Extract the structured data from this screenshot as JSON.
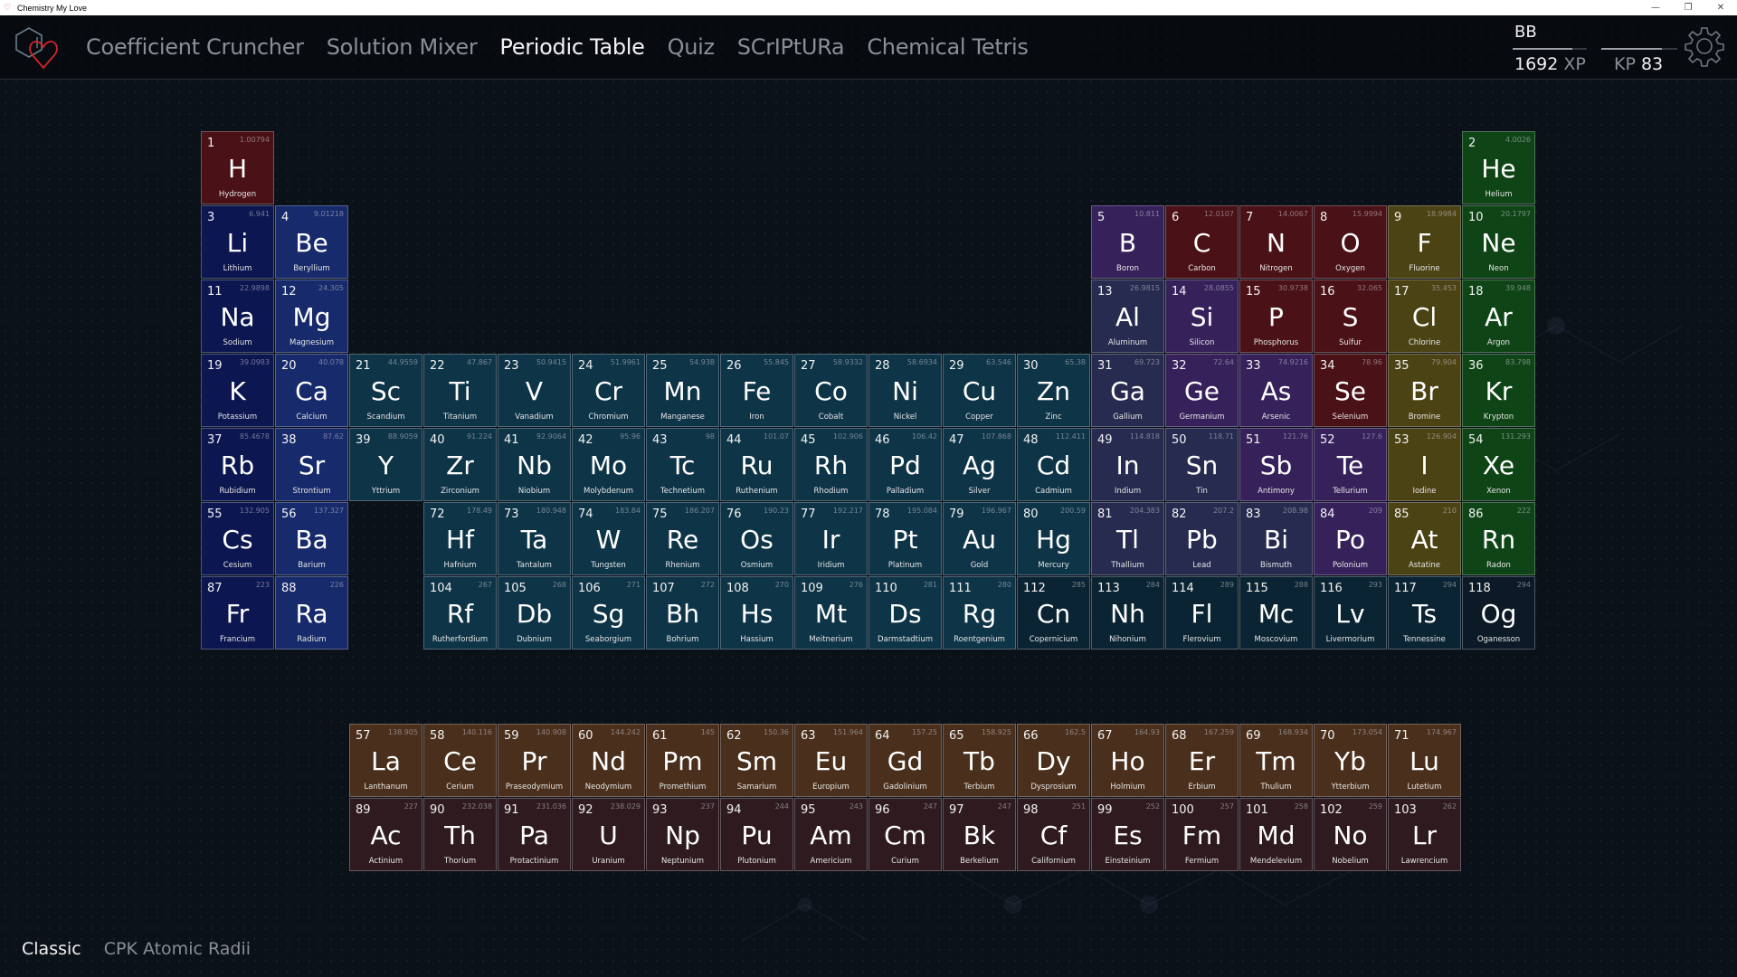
{
  "window": {
    "title": "Chemistry My Love",
    "controls": [
      "minimize",
      "restore",
      "close"
    ]
  },
  "nav": {
    "items": [
      {
        "label": "Coefficient Cruncher",
        "active": false
      },
      {
        "label": "Solution Mixer",
        "active": false
      },
      {
        "label": "Periodic Table",
        "active": true
      },
      {
        "label": "Quiz",
        "active": false
      },
      {
        "label": "SCrIPtURa",
        "active": false
      },
      {
        "label": "Chemical Tetris",
        "active": false
      }
    ]
  },
  "user": {
    "name": "BB",
    "xp_value": "1692",
    "xp_unit": "XP",
    "kp_unit": "KP",
    "kp_value": "83",
    "xp_progress": 0.8,
    "kp_progress": 0.8
  },
  "colors": {
    "nonmetal": "#4a1116",
    "alkali": "#0c1650",
    "alkaline": "#172a6b",
    "transition": "#0e3447",
    "post_transition": "#272b4f",
    "metalloid": "#36215b",
    "halogen": "#4c4314",
    "noble": "#0f4516",
    "lanthanide": "#4a2f1c",
    "actinide": "#2f1b1f",
    "unknown": "#0b2433",
    "unknown_dark": "#0b1a26"
  },
  "elements": [
    {
      "n": "1",
      "m": "1.00794",
      "s": "H",
      "name": "Hydrogen",
      "row": 1,
      "col": 1,
      "cat": "nonmetal"
    },
    {
      "n": "2",
      "m": "4.0026",
      "s": "He",
      "name": "Helium",
      "row": 1,
      "col": 18,
      "cat": "noble"
    },
    {
      "n": "3",
      "m": "6.941",
      "s": "Li",
      "name": "Lithium",
      "row": 2,
      "col": 1,
      "cat": "alkali"
    },
    {
      "n": "4",
      "m": "9.01218",
      "s": "Be",
      "name": "Beryllium",
      "row": 2,
      "col": 2,
      "cat": "alkaline"
    },
    {
      "n": "5",
      "m": "10.811",
      "s": "B",
      "name": "Boron",
      "row": 2,
      "col": 13,
      "cat": "metalloid"
    },
    {
      "n": "6",
      "m": "12.0107",
      "s": "C",
      "name": "Carbon",
      "row": 2,
      "col": 14,
      "cat": "nonmetal"
    },
    {
      "n": "7",
      "m": "14.0067",
      "s": "N",
      "name": "Nitrogen",
      "row": 2,
      "col": 15,
      "cat": "nonmetal"
    },
    {
      "n": "8",
      "m": "15.9994",
      "s": "O",
      "name": "Oxygen",
      "row": 2,
      "col": 16,
      "cat": "nonmetal"
    },
    {
      "n": "9",
      "m": "18.9984",
      "s": "F",
      "name": "Fluorine",
      "row": 2,
      "col": 17,
      "cat": "halogen"
    },
    {
      "n": "10",
      "m": "20.1797",
      "s": "Ne",
      "name": "Neon",
      "row": 2,
      "col": 18,
      "cat": "noble"
    },
    {
      "n": "11",
      "m": "22.9898",
      "s": "Na",
      "name": "Sodium",
      "row": 3,
      "col": 1,
      "cat": "alkali"
    },
    {
      "n": "12",
      "m": "24.305",
      "s": "Mg",
      "name": "Magnesium",
      "row": 3,
      "col": 2,
      "cat": "alkaline"
    },
    {
      "n": "13",
      "m": "26.9815",
      "s": "Al",
      "name": "Aluminum",
      "row": 3,
      "col": 13,
      "cat": "post_transition"
    },
    {
      "n": "14",
      "m": "28.0855",
      "s": "Si",
      "name": "Silicon",
      "row": 3,
      "col": 14,
      "cat": "metalloid"
    },
    {
      "n": "15",
      "m": "30.9738",
      "s": "P",
      "name": "Phosphorus",
      "row": 3,
      "col": 15,
      "cat": "nonmetal"
    },
    {
      "n": "16",
      "m": "32.065",
      "s": "S",
      "name": "Sulfur",
      "row": 3,
      "col": 16,
      "cat": "nonmetal"
    },
    {
      "n": "17",
      "m": "35.453",
      "s": "Cl",
      "name": "Chlorine",
      "row": 3,
      "col": 17,
      "cat": "halogen"
    },
    {
      "n": "18",
      "m": "39.948",
      "s": "Ar",
      "name": "Argon",
      "row": 3,
      "col": 18,
      "cat": "noble"
    },
    {
      "n": "19",
      "m": "39.0983",
      "s": "K",
      "name": "Potassium",
      "row": 4,
      "col": 1,
      "cat": "alkali"
    },
    {
      "n": "20",
      "m": "40.078",
      "s": "Ca",
      "name": "Calcium",
      "row": 4,
      "col": 2,
      "cat": "alkaline"
    },
    {
      "n": "21",
      "m": "44.9559",
      "s": "Sc",
      "name": "Scandium",
      "row": 4,
      "col": 3,
      "cat": "transition"
    },
    {
      "n": "22",
      "m": "47.867",
      "s": "Ti",
      "name": "Titanium",
      "row": 4,
      "col": 4,
      "cat": "transition"
    },
    {
      "n": "23",
      "m": "50.9415",
      "s": "V",
      "name": "Vanadium",
      "row": 4,
      "col": 5,
      "cat": "transition"
    },
    {
      "n": "24",
      "m": "51.9961",
      "s": "Cr",
      "name": "Chromium",
      "row": 4,
      "col": 6,
      "cat": "transition"
    },
    {
      "n": "25",
      "m": "54.938",
      "s": "Mn",
      "name": "Manganese",
      "row": 4,
      "col": 7,
      "cat": "transition"
    },
    {
      "n": "26",
      "m": "55.845",
      "s": "Fe",
      "name": "Iron",
      "row": 4,
      "col": 8,
      "cat": "transition"
    },
    {
      "n": "27",
      "m": "58.9332",
      "s": "Co",
      "name": "Cobalt",
      "row": 4,
      "col": 9,
      "cat": "transition"
    },
    {
      "n": "28",
      "m": "58.6934",
      "s": "Ni",
      "name": "Nickel",
      "row": 4,
      "col": 10,
      "cat": "transition"
    },
    {
      "n": "29",
      "m": "63.546",
      "s": "Cu",
      "name": "Copper",
      "row": 4,
      "col": 11,
      "cat": "transition"
    },
    {
      "n": "30",
      "m": "65.38",
      "s": "Zn",
      "name": "Zinc",
      "row": 4,
      "col": 12,
      "cat": "transition"
    },
    {
      "n": "31",
      "m": "69.723",
      "s": "Ga",
      "name": "Gallium",
      "row": 4,
      "col": 13,
      "cat": "post_transition"
    },
    {
      "n": "32",
      "m": "72.64",
      "s": "Ge",
      "name": "Germanium",
      "row": 4,
      "col": 14,
      "cat": "metalloid"
    },
    {
      "n": "33",
      "m": "74.9216",
      "s": "As",
      "name": "Arsenic",
      "row": 4,
      "col": 15,
      "cat": "metalloid"
    },
    {
      "n": "34",
      "m": "78.96",
      "s": "Se",
      "name": "Selenium",
      "row": 4,
      "col": 16,
      "cat": "nonmetal"
    },
    {
      "n": "35",
      "m": "79.904",
      "s": "Br",
      "name": "Bromine",
      "row": 4,
      "col": 17,
      "cat": "halogen"
    },
    {
      "n": "36",
      "m": "83.798",
      "s": "Kr",
      "name": "Krypton",
      "row": 4,
      "col": 18,
      "cat": "noble"
    },
    {
      "n": "37",
      "m": "85.4678",
      "s": "Rb",
      "name": "Rubidium",
      "row": 5,
      "col": 1,
      "cat": "alkali"
    },
    {
      "n": "38",
      "m": "87.62",
      "s": "Sr",
      "name": "Strontium",
      "row": 5,
      "col": 2,
      "cat": "alkaline"
    },
    {
      "n": "39",
      "m": "88.9059",
      "s": "Y",
      "name": "Yttrium",
      "row": 5,
      "col": 3,
      "cat": "transition"
    },
    {
      "n": "40",
      "m": "91.224",
      "s": "Zr",
      "name": "Zirconium",
      "row": 5,
      "col": 4,
      "cat": "transition"
    },
    {
      "n": "41",
      "m": "92.9064",
      "s": "Nb",
      "name": "Niobium",
      "row": 5,
      "col": 5,
      "cat": "transition"
    },
    {
      "n": "42",
      "m": "95.96",
      "s": "Mo",
      "name": "Molybdenum",
      "row": 5,
      "col": 6,
      "cat": "transition"
    },
    {
      "n": "43",
      "m": "98",
      "s": "Tc",
      "name": "Technetium",
      "row": 5,
      "col": 7,
      "cat": "transition"
    },
    {
      "n": "44",
      "m": "101.07",
      "s": "Ru",
      "name": "Ruthenium",
      "row": 5,
      "col": 8,
      "cat": "transition"
    },
    {
      "n": "45",
      "m": "102.906",
      "s": "Rh",
      "name": "Rhodium",
      "row": 5,
      "col": 9,
      "cat": "transition"
    },
    {
      "n": "46",
      "m": "106.42",
      "s": "Pd",
      "name": "Palladium",
      "row": 5,
      "col": 10,
      "cat": "transition"
    },
    {
      "n": "47",
      "m": "107.868",
      "s": "Ag",
      "name": "Silver",
      "row": 5,
      "col": 11,
      "cat": "transition"
    },
    {
      "n": "48",
      "m": "112.411",
      "s": "Cd",
      "name": "Cadmium",
      "row": 5,
      "col": 12,
      "cat": "transition"
    },
    {
      "n": "49",
      "m": "114.818",
      "s": "In",
      "name": "Indium",
      "row": 5,
      "col": 13,
      "cat": "post_transition"
    },
    {
      "n": "50",
      "m": "118.71",
      "s": "Sn",
      "name": "Tin",
      "row": 5,
      "col": 14,
      "cat": "post_transition"
    },
    {
      "n": "51",
      "m": "121.76",
      "s": "Sb",
      "name": "Antimony",
      "row": 5,
      "col": 15,
      "cat": "metalloid"
    },
    {
      "n": "52",
      "m": "127.6",
      "s": "Te",
      "name": "Tellurium",
      "row": 5,
      "col": 16,
      "cat": "metalloid"
    },
    {
      "n": "53",
      "m": "126.904",
      "s": "I",
      "name": "Iodine",
      "row": 5,
      "col": 17,
      "cat": "halogen"
    },
    {
      "n": "54",
      "m": "131.293",
      "s": "Xe",
      "name": "Xenon",
      "row": 5,
      "col": 18,
      "cat": "noble"
    },
    {
      "n": "55",
      "m": "132.905",
      "s": "Cs",
      "name": "Cesium",
      "row": 6,
      "col": 1,
      "cat": "alkali"
    },
    {
      "n": "56",
      "m": "137.327",
      "s": "Ba",
      "name": "Barium",
      "row": 6,
      "col": 2,
      "cat": "alkaline"
    },
    {
      "n": "72",
      "m": "178.49",
      "s": "Hf",
      "name": "Hafnium",
      "row": 6,
      "col": 4,
      "cat": "transition"
    },
    {
      "n": "73",
      "m": "180.948",
      "s": "Ta",
      "name": "Tantalum",
      "row": 6,
      "col": 5,
      "cat": "transition"
    },
    {
      "n": "74",
      "m": "183.84",
      "s": "W",
      "name": "Tungsten",
      "row": 6,
      "col": 6,
      "cat": "transition"
    },
    {
      "n": "75",
      "m": "186.207",
      "s": "Re",
      "name": "Rhenium",
      "row": 6,
      "col": 7,
      "cat": "transition"
    },
    {
      "n": "76",
      "m": "190.23",
      "s": "Os",
      "name": "Osmium",
      "row": 6,
      "col": 8,
      "cat": "transition"
    },
    {
      "n": "77",
      "m": "192.217",
      "s": "Ir",
      "name": "Iridium",
      "row": 6,
      "col": 9,
      "cat": "transition"
    },
    {
      "n": "78",
      "m": "195.084",
      "s": "Pt",
      "name": "Platinum",
      "row": 6,
      "col": 10,
      "cat": "transition"
    },
    {
      "n": "79",
      "m": "196.967",
      "s": "Au",
      "name": "Gold",
      "row": 6,
      "col": 11,
      "cat": "transition"
    },
    {
      "n": "80",
      "m": "200.59",
      "s": "Hg",
      "name": "Mercury",
      "row": 6,
      "col": 12,
      "cat": "transition"
    },
    {
      "n": "81",
      "m": "204.383",
      "s": "Tl",
      "name": "Thallium",
      "row": 6,
      "col": 13,
      "cat": "post_transition"
    },
    {
      "n": "82",
      "m": "207.2",
      "s": "Pb",
      "name": "Lead",
      "row": 6,
      "col": 14,
      "cat": "post_transition"
    },
    {
      "n": "83",
      "m": "208.98",
      "s": "Bi",
      "name": "Bismuth",
      "row": 6,
      "col": 15,
      "cat": "post_transition"
    },
    {
      "n": "84",
      "m": "209",
      "s": "Po",
      "name": "Polonium",
      "row": 6,
      "col": 16,
      "cat": "metalloid"
    },
    {
      "n": "85",
      "m": "210",
      "s": "At",
      "name": "Astatine",
      "row": 6,
      "col": 17,
      "cat": "halogen"
    },
    {
      "n": "86",
      "m": "222",
      "s": "Rn",
      "name": "Radon",
      "row": 6,
      "col": 18,
      "cat": "noble"
    },
    {
      "n": "87",
      "m": "223",
      "s": "Fr",
      "name": "Francium",
      "row": 7,
      "col": 1,
      "cat": "alkali"
    },
    {
      "n": "88",
      "m": "226",
      "s": "Ra",
      "name": "Radium",
      "row": 7,
      "col": 2,
      "cat": "alkaline"
    },
    {
      "n": "104",
      "m": "267",
      "s": "Rf",
      "name": "Rutherfordium",
      "row": 7,
      "col": 4,
      "cat": "transition"
    },
    {
      "n": "105",
      "m": "268",
      "s": "Db",
      "name": "Dubnium",
      "row": 7,
      "col": 5,
      "cat": "transition"
    },
    {
      "n": "106",
      "m": "271",
      "s": "Sg",
      "name": "Seaborgium",
      "row": 7,
      "col": 6,
      "cat": "transition"
    },
    {
      "n": "107",
      "m": "272",
      "s": "Bh",
      "name": "Bohrium",
      "row": 7,
      "col": 7,
      "cat": "transition"
    },
    {
      "n": "108",
      "m": "270",
      "s": "Hs",
      "name": "Hassium",
      "row": 7,
      "col": 8,
      "cat": "transition"
    },
    {
      "n": "109",
      "m": "276",
      "s": "Mt",
      "name": "Meitnerium",
      "row": 7,
      "col": 9,
      "cat": "transition"
    },
    {
      "n": "110",
      "m": "281",
      "s": "Ds",
      "name": "Darmstadtium",
      "row": 7,
      "col": 10,
      "cat": "transition"
    },
    {
      "n": "111",
      "m": "280",
      "s": "Rg",
      "name": "Roentgenium",
      "row": 7,
      "col": 11,
      "cat": "transition"
    },
    {
      "n": "112",
      "m": "285",
      "s": "Cn",
      "name": "Copernicium",
      "row": 7,
      "col": 12,
      "cat": "unknown"
    },
    {
      "n": "113",
      "m": "284",
      "s": "Nh",
      "name": "Nihonium",
      "row": 7,
      "col": 13,
      "cat": "unknown"
    },
    {
      "n": "114",
      "m": "289",
      "s": "Fl",
      "name": "Flerovium",
      "row": 7,
      "col": 14,
      "cat": "unknown"
    },
    {
      "n": "115",
      "m": "288",
      "s": "Mc",
      "name": "Moscovium",
      "row": 7,
      "col": 15,
      "cat": "unknown"
    },
    {
      "n": "116",
      "m": "293",
      "s": "Lv",
      "name": "Livermorium",
      "row": 7,
      "col": 16,
      "cat": "unknown"
    },
    {
      "n": "117",
      "m": "294",
      "s": "Ts",
      "name": "Tennessine",
      "row": 7,
      "col": 17,
      "cat": "unknown"
    },
    {
      "n": "118",
      "m": "294",
      "s": "Og",
      "name": "Oganesson",
      "row": 7,
      "col": 18,
      "cat": "unknown_dark"
    },
    {
      "n": "57",
      "m": "138.905",
      "s": "La",
      "name": "Lanthanum",
      "row": 9,
      "col": 3,
      "cat": "lanthanide"
    },
    {
      "n": "58",
      "m": "140.116",
      "s": "Ce",
      "name": "Cerium",
      "row": 9,
      "col": 4,
      "cat": "lanthanide"
    },
    {
      "n": "59",
      "m": "140.908",
      "s": "Pr",
      "name": "Praseodymium",
      "row": 9,
      "col": 5,
      "cat": "lanthanide"
    },
    {
      "n": "60",
      "m": "144.242",
      "s": "Nd",
      "name": "Neodymium",
      "row": 9,
      "col": 6,
      "cat": "lanthanide"
    },
    {
      "n": "61",
      "m": "145",
      "s": "Pm",
      "name": "Promethium",
      "row": 9,
      "col": 7,
      "cat": "lanthanide"
    },
    {
      "n": "62",
      "m": "150.36",
      "s": "Sm",
      "name": "Samarium",
      "row": 9,
      "col": 8,
      "cat": "lanthanide"
    },
    {
      "n": "63",
      "m": "151.964",
      "s": "Eu",
      "name": "Europium",
      "row": 9,
      "col": 9,
      "cat": "lanthanide"
    },
    {
      "n": "64",
      "m": "157.25",
      "s": "Gd",
      "name": "Gadolinium",
      "row": 9,
      "col": 10,
      "cat": "lanthanide"
    },
    {
      "n": "65",
      "m": "158.925",
      "s": "Tb",
      "name": "Terbium",
      "row": 9,
      "col": 11,
      "cat": "lanthanide"
    },
    {
      "n": "66",
      "m": "162.5",
      "s": "Dy",
      "name": "Dysprosium",
      "row": 9,
      "col": 12,
      "cat": "lanthanide"
    },
    {
      "n": "67",
      "m": "164.93",
      "s": "Ho",
      "name": "Holmium",
      "row": 9,
      "col": 13,
      "cat": "lanthanide"
    },
    {
      "n": "68",
      "m": "167.259",
      "s": "Er",
      "name": "Erbium",
      "row": 9,
      "col": 14,
      "cat": "lanthanide"
    },
    {
      "n": "69",
      "m": "168.934",
      "s": "Tm",
      "name": "Thulium",
      "row": 9,
      "col": 15,
      "cat": "lanthanide"
    },
    {
      "n": "70",
      "m": "173.054",
      "s": "Yb",
      "name": "Ytterbium",
      "row": 9,
      "col": 16,
      "cat": "lanthanide"
    },
    {
      "n": "71",
      "m": "174.967",
      "s": "Lu",
      "name": "Lutetium",
      "row": 9,
      "col": 17,
      "cat": "lanthanide"
    },
    {
      "n": "89",
      "m": "227",
      "s": "Ac",
      "name": "Actinium",
      "row": 10,
      "col": 3,
      "cat": "actinide"
    },
    {
      "n": "90",
      "m": "232.038",
      "s": "Th",
      "name": "Thorium",
      "row": 10,
      "col": 4,
      "cat": "actinide"
    },
    {
      "n": "91",
      "m": "231.036",
      "s": "Pa",
      "name": "Protactinium",
      "row": 10,
      "col": 5,
      "cat": "actinide"
    },
    {
      "n": "92",
      "m": "238.029",
      "s": "U",
      "name": "Uranium",
      "row": 10,
      "col": 6,
      "cat": "actinide"
    },
    {
      "n": "93",
      "m": "237",
      "s": "Np",
      "name": "Neptunium",
      "row": 10,
      "col": 7,
      "cat": "actinide"
    },
    {
      "n": "94",
      "m": "244",
      "s": "Pu",
      "name": "Plutonium",
      "row": 10,
      "col": 8,
      "cat": "actinide"
    },
    {
      "n": "95",
      "m": "243",
      "s": "Am",
      "name": "Americium",
      "row": 10,
      "col": 9,
      "cat": "actinide"
    },
    {
      "n": "96",
      "m": "247",
      "s": "Cm",
      "name": "Curium",
      "row": 10,
      "col": 10,
      "cat": "actinide"
    },
    {
      "n": "97",
      "m": "247",
      "s": "Bk",
      "name": "Berkelium",
      "row": 10,
      "col": 11,
      "cat": "actinide"
    },
    {
      "n": "98",
      "m": "251",
      "s": "Cf",
      "name": "Californium",
      "row": 10,
      "col": 12,
      "cat": "actinide"
    },
    {
      "n": "99",
      "m": "252",
      "s": "Es",
      "name": "Einsteinium",
      "row": 10,
      "col": 13,
      "cat": "actinide"
    },
    {
      "n": "100",
      "m": "257",
      "s": "Fm",
      "name": "Fermium",
      "row": 10,
      "col": 14,
      "cat": "actinide"
    },
    {
      "n": "101",
      "m": "258",
      "s": "Md",
      "name": "Mendelevium",
      "row": 10,
      "col": 15,
      "cat": "actinide"
    },
    {
      "n": "102",
      "m": "259",
      "s": "No",
      "name": "Nobelium",
      "row": 10,
      "col": 16,
      "cat": "actinide"
    },
    {
      "n": "103",
      "m": "262",
      "s": "Lr",
      "name": "Lawrencium",
      "row": 10,
      "col": 17,
      "cat": "actinide"
    }
  ],
  "footer": {
    "tabs": [
      {
        "label": "Classic",
        "active": true
      },
      {
        "label": "CPK Atomic Radii",
        "active": false
      }
    ]
  }
}
